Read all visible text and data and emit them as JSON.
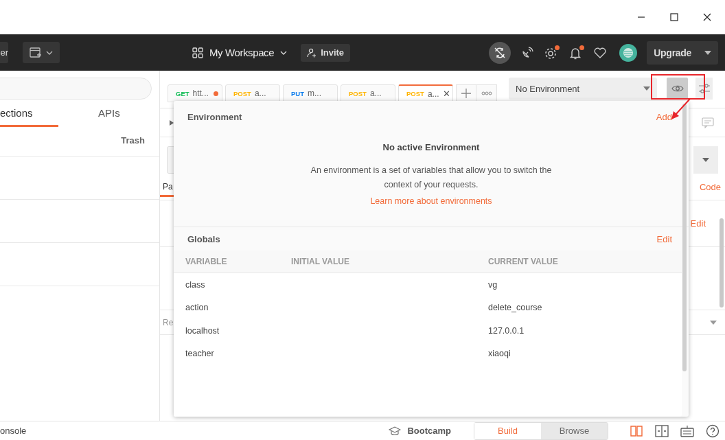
{
  "header": {
    "cut_button": "er",
    "workspace": "My Workspace",
    "invite": "Invite",
    "upgrade": "Upgrade",
    "icons": [
      {
        "kind": "sync"
      },
      {
        "kind": "satellite"
      },
      {
        "kind": "settings",
        "badge": true
      },
      {
        "kind": "bell",
        "badge": true
      },
      {
        "kind": "heart",
        "badge": false
      }
    ]
  },
  "sidebar": {
    "tabs": [
      {
        "label": "ections",
        "selected": true
      },
      {
        "label": "APIs",
        "selected": false
      }
    ],
    "trash": "Trash"
  },
  "request_tabs": [
    {
      "method": "GET",
      "color": "#0cbb52",
      "title": "htt...",
      "unsaved": true,
      "selected": false
    },
    {
      "method": "POST",
      "color": "#ffb400",
      "title": "a...",
      "unsaved": false,
      "selected": false
    },
    {
      "method": "PUT",
      "color": "#097bed",
      "title": "m...",
      "unsaved": false,
      "selected": false
    },
    {
      "method": "POST",
      "color": "#ffb400",
      "title": "a...",
      "unsaved": false,
      "selected": false
    },
    {
      "method": "POST",
      "color": "#ffb400",
      "title": "a...",
      "unsaved": false,
      "selected": true,
      "close": "✕"
    }
  ],
  "environment": {
    "selected": "No Environment",
    "quick_look_selected": true
  },
  "request_area": {
    "params_tab": "Pa",
    "code": "Code",
    "edit": "Edit",
    "response": "Re"
  },
  "popover": {
    "title": "Environment",
    "add": "Add",
    "empty_title": "No active Environment",
    "empty_text": "An environment is a set of variables that allow you to switch the context of your requests.",
    "learn_more": "Learn more about environments",
    "globals": {
      "title": "Globals",
      "edit": "Edit",
      "columns": [
        "VARIABLE",
        "INITIAL VALUE",
        "CURRENT VALUE"
      ],
      "rows": [
        {
          "variable": "class",
          "current_value": "vg"
        },
        {
          "variable": "action",
          "current_value": "delete_course"
        },
        {
          "variable": "localhost",
          "current_value": "127.0.0.1"
        },
        {
          "variable": "teacher",
          "current_value": "xiaoqi"
        }
      ]
    }
  },
  "status_bar": {
    "console": "onsole",
    "bootcamp": "Bootcamp",
    "modes": [
      {
        "label": "Build",
        "selected": true
      },
      {
        "label": "Browse",
        "selected": false
      }
    ]
  }
}
